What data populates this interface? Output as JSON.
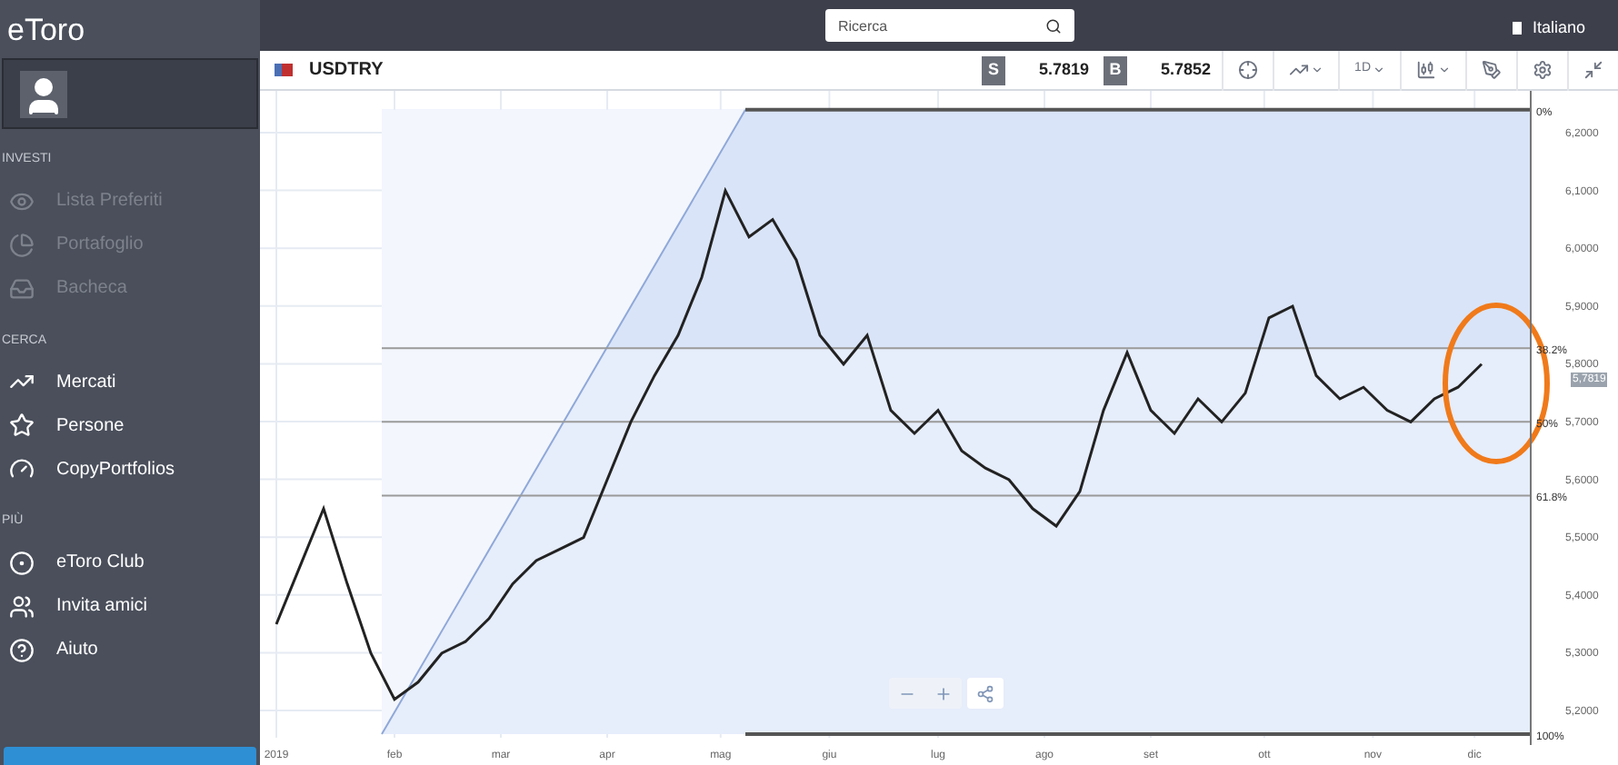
{
  "sidebar": {
    "brand": "eToro",
    "sections": [
      {
        "title": "INVESTI",
        "items": [
          {
            "label": "Lista Preferiti",
            "disabled": true
          },
          {
            "label": "Portafoglio",
            "disabled": true
          },
          {
            "label": "Bacheca",
            "disabled": true
          }
        ]
      },
      {
        "title": "CERCA",
        "items": [
          {
            "label": "Mercati",
            "disabled": false
          },
          {
            "label": "Persone",
            "disabled": false
          },
          {
            "label": "CopyPortfolios",
            "disabled": false
          }
        ]
      },
      {
        "title": "PIÙ",
        "items": [
          {
            "label": "eToro Club",
            "disabled": false
          },
          {
            "label": "Invita amici",
            "disabled": false
          },
          {
            "label": "Aiuto",
            "disabled": false
          }
        ]
      }
    ]
  },
  "topbar": {
    "search": {
      "placeholder": "Ricerca"
    },
    "language": "Italiano"
  },
  "instrument": {
    "symbol": "USDTRY",
    "sell_label": "S",
    "sell": "5.7819",
    "buy_label": "B",
    "buy": "5.7852",
    "timeframe": "1D"
  },
  "chart": {
    "price_tag": "5,7819",
    "x_axis_labels": [
      "2019",
      "feb",
      "mar",
      "apr",
      "mag",
      "giu",
      "lug",
      "ago",
      "set",
      "ott",
      "nov",
      "dic"
    ],
    "y_axis_labels": [
      "6,2000",
      "6,1000",
      "6,0000",
      "5,9000",
      "5,8000",
      "5,7000",
      "5,6000",
      "5,5000",
      "5,4000",
      "5,3000",
      "5,2000"
    ],
    "fib_levels": [
      {
        "label": "0%"
      },
      {
        "label": "38.2%"
      },
      {
        "label": "50%"
      },
      {
        "label": "61.8%"
      },
      {
        "label": "100%"
      }
    ]
  }
}
